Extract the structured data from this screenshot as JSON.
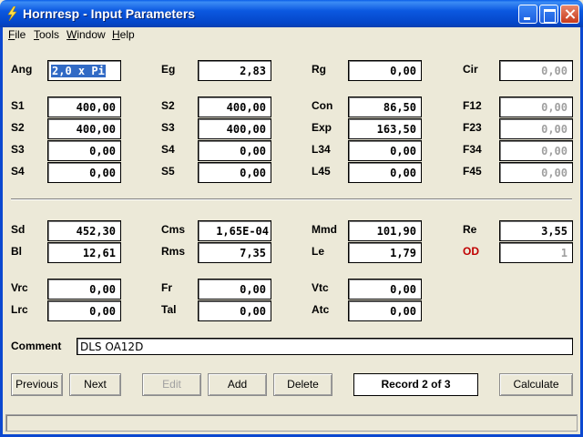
{
  "window": {
    "title": "Hornresp - Input Parameters"
  },
  "menu": [
    "File",
    "Tools",
    "Window",
    "Help"
  ],
  "fields": {
    "ang": {
      "label": "Ang",
      "value": "2,0 x Pi"
    },
    "eg": {
      "label": "Eg",
      "value": "2,83"
    },
    "rg": {
      "label": "Rg",
      "value": "0,00"
    },
    "cir": {
      "label": "Cir",
      "value": "0,00"
    },
    "s1": {
      "label": "S1",
      "value": "400,00"
    },
    "s2a": {
      "label": "S2",
      "value": "400,00"
    },
    "con": {
      "label": "Con",
      "value": "86,50"
    },
    "f12": {
      "label": "F12",
      "value": "0,00"
    },
    "s2b": {
      "label": "S2",
      "value": "400,00"
    },
    "s3a": {
      "label": "S3",
      "value": "400,00"
    },
    "exp": {
      "label": "Exp",
      "value": "163,50"
    },
    "f23": {
      "label": "F23",
      "value": "0,00"
    },
    "s3b": {
      "label": "S3",
      "value": "0,00"
    },
    "s4a": {
      "label": "S4",
      "value": "0,00"
    },
    "l34": {
      "label": "L34",
      "value": "0,00"
    },
    "f34": {
      "label": "F34",
      "value": "0,00"
    },
    "s4b": {
      "label": "S4",
      "value": "0,00"
    },
    "s5": {
      "label": "S5",
      "value": "0,00"
    },
    "l45": {
      "label": "L45",
      "value": "0,00"
    },
    "f45": {
      "label": "F45",
      "value": "0,00"
    },
    "sd": {
      "label": "Sd",
      "value": "452,30"
    },
    "cms": {
      "label": "Cms",
      "value": "1,65E-04"
    },
    "mmd": {
      "label": "Mmd",
      "value": "101,90"
    },
    "re": {
      "label": "Re",
      "value": "3,55"
    },
    "bl": {
      "label": "Bl",
      "value": "12,61"
    },
    "rms": {
      "label": "Rms",
      "value": "7,35"
    },
    "le": {
      "label": "Le",
      "value": "1,79"
    },
    "od": {
      "label": "OD",
      "value": "1"
    },
    "vrc": {
      "label": "Vrc",
      "value": "0,00"
    },
    "fr": {
      "label": "Fr",
      "value": "0,00"
    },
    "vtc": {
      "label": "Vtc",
      "value": "0,00"
    },
    "lrc": {
      "label": "Lrc",
      "value": "0,00"
    },
    "tal": {
      "label": "Tal",
      "value": "0,00"
    },
    "atc": {
      "label": "Atc",
      "value": "0,00"
    }
  },
  "comment": {
    "label": "Comment",
    "value": "DLS OA12D"
  },
  "buttons": {
    "previous": "Previous",
    "next": "Next",
    "edit": "Edit",
    "add": "Add",
    "delete": "Delete",
    "calculate": "Calculate"
  },
  "record": "Record 2 of 3",
  "colors": {
    "od_label": "#c00000",
    "title_bar": "#0b58e0",
    "selection": "#316ac5"
  }
}
